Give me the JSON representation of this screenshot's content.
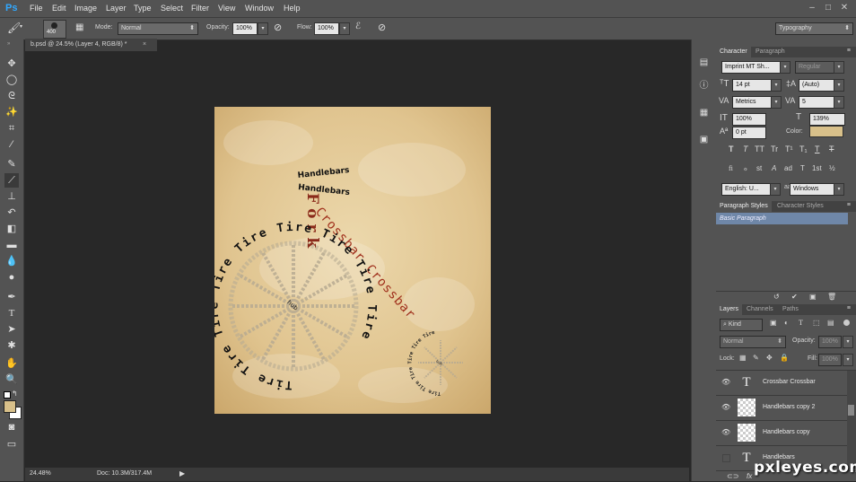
{
  "app": {
    "logo": "Ps"
  },
  "menu": [
    "File",
    "Edit",
    "Image",
    "Layer",
    "Type",
    "Select",
    "Filter",
    "View",
    "Window",
    "Help"
  ],
  "options_bar": {
    "brush_size": "400",
    "mode_label": "Mode:",
    "mode_value": "Normal",
    "opacity_label": "Opacity:",
    "opacity_value": "100%",
    "flow_label": "Flow:",
    "flow_value": "100%",
    "workspace": "Typography"
  },
  "document_tab": {
    "title": "b.psd @ 24.5% (Layer 4, RGB/8) *",
    "close": "×"
  },
  "status": {
    "zoom": "24.48%",
    "doc": "Doc: 10.3M/317.4M"
  },
  "character_panel": {
    "tabs": [
      "Character",
      "Paragraph"
    ],
    "font_family": "Imprint MT Sh...",
    "font_style": "Regular",
    "font_size": "14 pt",
    "leading": "(Auto)",
    "kerning": "Metrics",
    "tracking": "5",
    "vertical_scale": "100%",
    "horizontal_scale": "139%",
    "baseline_shift": "0 pt",
    "color_label": "Color:",
    "color": "#d8c08a",
    "style_buttons": [
      "T",
      "T",
      "TT",
      "Tr",
      "T¹",
      "T₁",
      "T",
      "T"
    ],
    "opentype_buttons": [
      "fi",
      "ℴ",
      "st",
      "A",
      "ad",
      "T",
      "1st",
      "½"
    ],
    "language": "English: U...",
    "antialias_icon": "aa",
    "antialias": "Windows"
  },
  "styles_panel": {
    "tabs": [
      "Paragraph Styles",
      "Character Styles"
    ],
    "items": [
      "Basic Paragraph"
    ]
  },
  "layers_panel": {
    "tabs": [
      "Layers",
      "Channels",
      "Paths"
    ],
    "filter_kind": "Kind",
    "blend_mode": "Normal",
    "opacity_label": "Opacity:",
    "opacity_value": "100%",
    "lock_label": "Lock:",
    "fill_label": "Fill:",
    "fill_value": "100%",
    "layers": [
      {
        "name": "Crossbar Crossbar",
        "type": "text",
        "visible": true
      },
      {
        "name": "Handlebars copy 2",
        "type": "raster",
        "visible": true
      },
      {
        "name": "Handlebars copy",
        "type": "raster",
        "visible": true
      },
      {
        "name": "Handlebars",
        "type": "text",
        "visible": false
      }
    ],
    "footer_icons": [
      "link-icon",
      "fx-icon"
    ]
  },
  "artwork": {
    "handlebars_1": "Handlebars",
    "handlebars_2": "Handlebars",
    "fork": "Fork",
    "crossbar": "Crossbar Crossbar",
    "big_tire": "Tire Tire Tire Tire Tire Tire Tire Tire Tire",
    "small_tire": "Tire Tire Tire Tire Tire Tire",
    "hub_big": "hub",
    "hub_small": "hub"
  },
  "watermark": "pxleyes.com",
  "colors": {
    "parchment": "#e2c896",
    "fork_red": "#8a2a1a",
    "crossbar_red": "#a0301c"
  }
}
